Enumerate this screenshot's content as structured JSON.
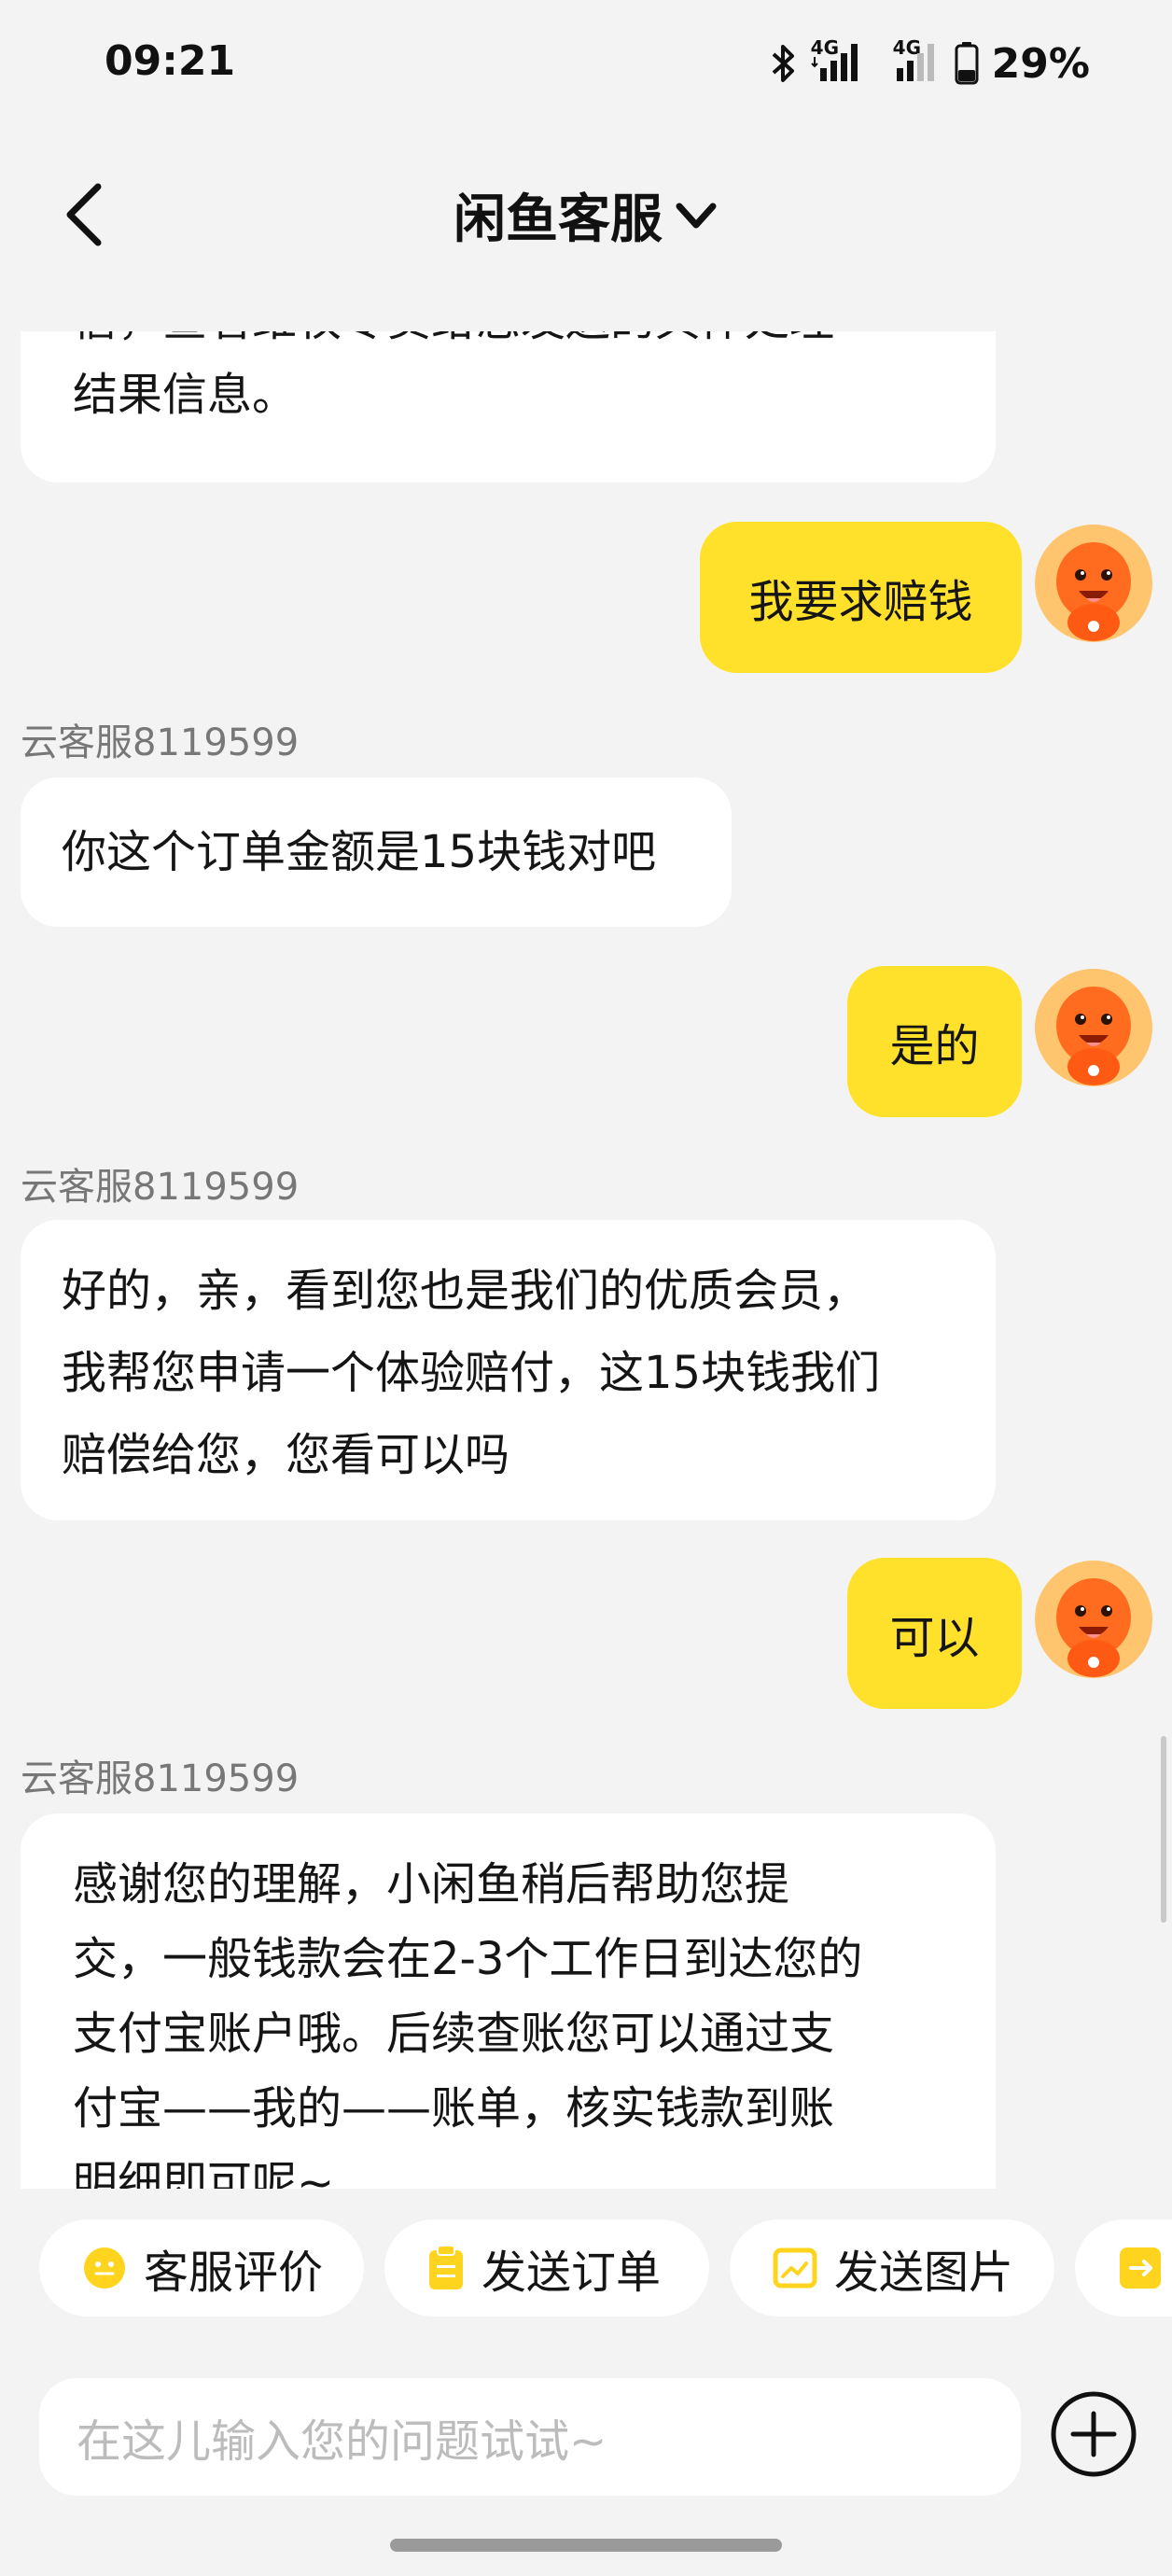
{
  "status_bar": {
    "time": "09:21",
    "network_1": "4G",
    "network_2": "4G",
    "battery": "29%",
    "icons": [
      "bluetooth-icon",
      "signal-icon",
      "signal-icon",
      "battery-icon"
    ]
  },
  "header": {
    "title": "闲鱼客服",
    "back_icon": "chevron-left-icon",
    "dropdown_icon": "chevron-down-icon"
  },
  "messages": [
    {
      "side": "left",
      "sender": "",
      "lines": [
        "信，查看维权专员给您发送的具体处理",
        "结果信息。"
      ]
    },
    {
      "side": "right",
      "text": "我要求赔钱"
    },
    {
      "side": "left",
      "sender": "云客服8119599",
      "lines": [
        "你这个订单金额是15块钱对吧"
      ]
    },
    {
      "side": "right",
      "text": "是的"
    },
    {
      "side": "left",
      "sender": "云客服8119599",
      "lines": [
        "好的，亲，看到您也是我们的优质会员，",
        "我帮您申请一个体验赔付，这15块钱我们",
        "赔偿给您，您看可以吗"
      ]
    },
    {
      "side": "right",
      "text": "可以"
    },
    {
      "side": "left",
      "sender": "云客服8119599",
      "lines": [
        "感谢您的理解，小闲鱼稍后帮助您提",
        "交，一般钱款会在2-3个工作日到达您的",
        "支付宝账户哦。后续查账您可以通过支",
        "付宝——我的——账单，核实钱款到账",
        "明细即可呢~"
      ]
    }
  ],
  "quick_actions": [
    {
      "label": "客服评价",
      "icon": "smiley-icon"
    },
    {
      "label": "发送订单",
      "icon": "clipboard-icon"
    },
    {
      "label": "发送图片",
      "icon": "image-icon"
    },
    {
      "label": "",
      "icon": "share-icon"
    }
  ],
  "input": {
    "placeholder": "在这儿输入您的问题试试~",
    "plus_icon": "plus-circle-icon"
  },
  "colors": {
    "accent": "#ffe12b",
    "background": "#f3f3f3",
    "bubble_left": "#ffffff",
    "quick_icon": "#ffd41f"
  }
}
